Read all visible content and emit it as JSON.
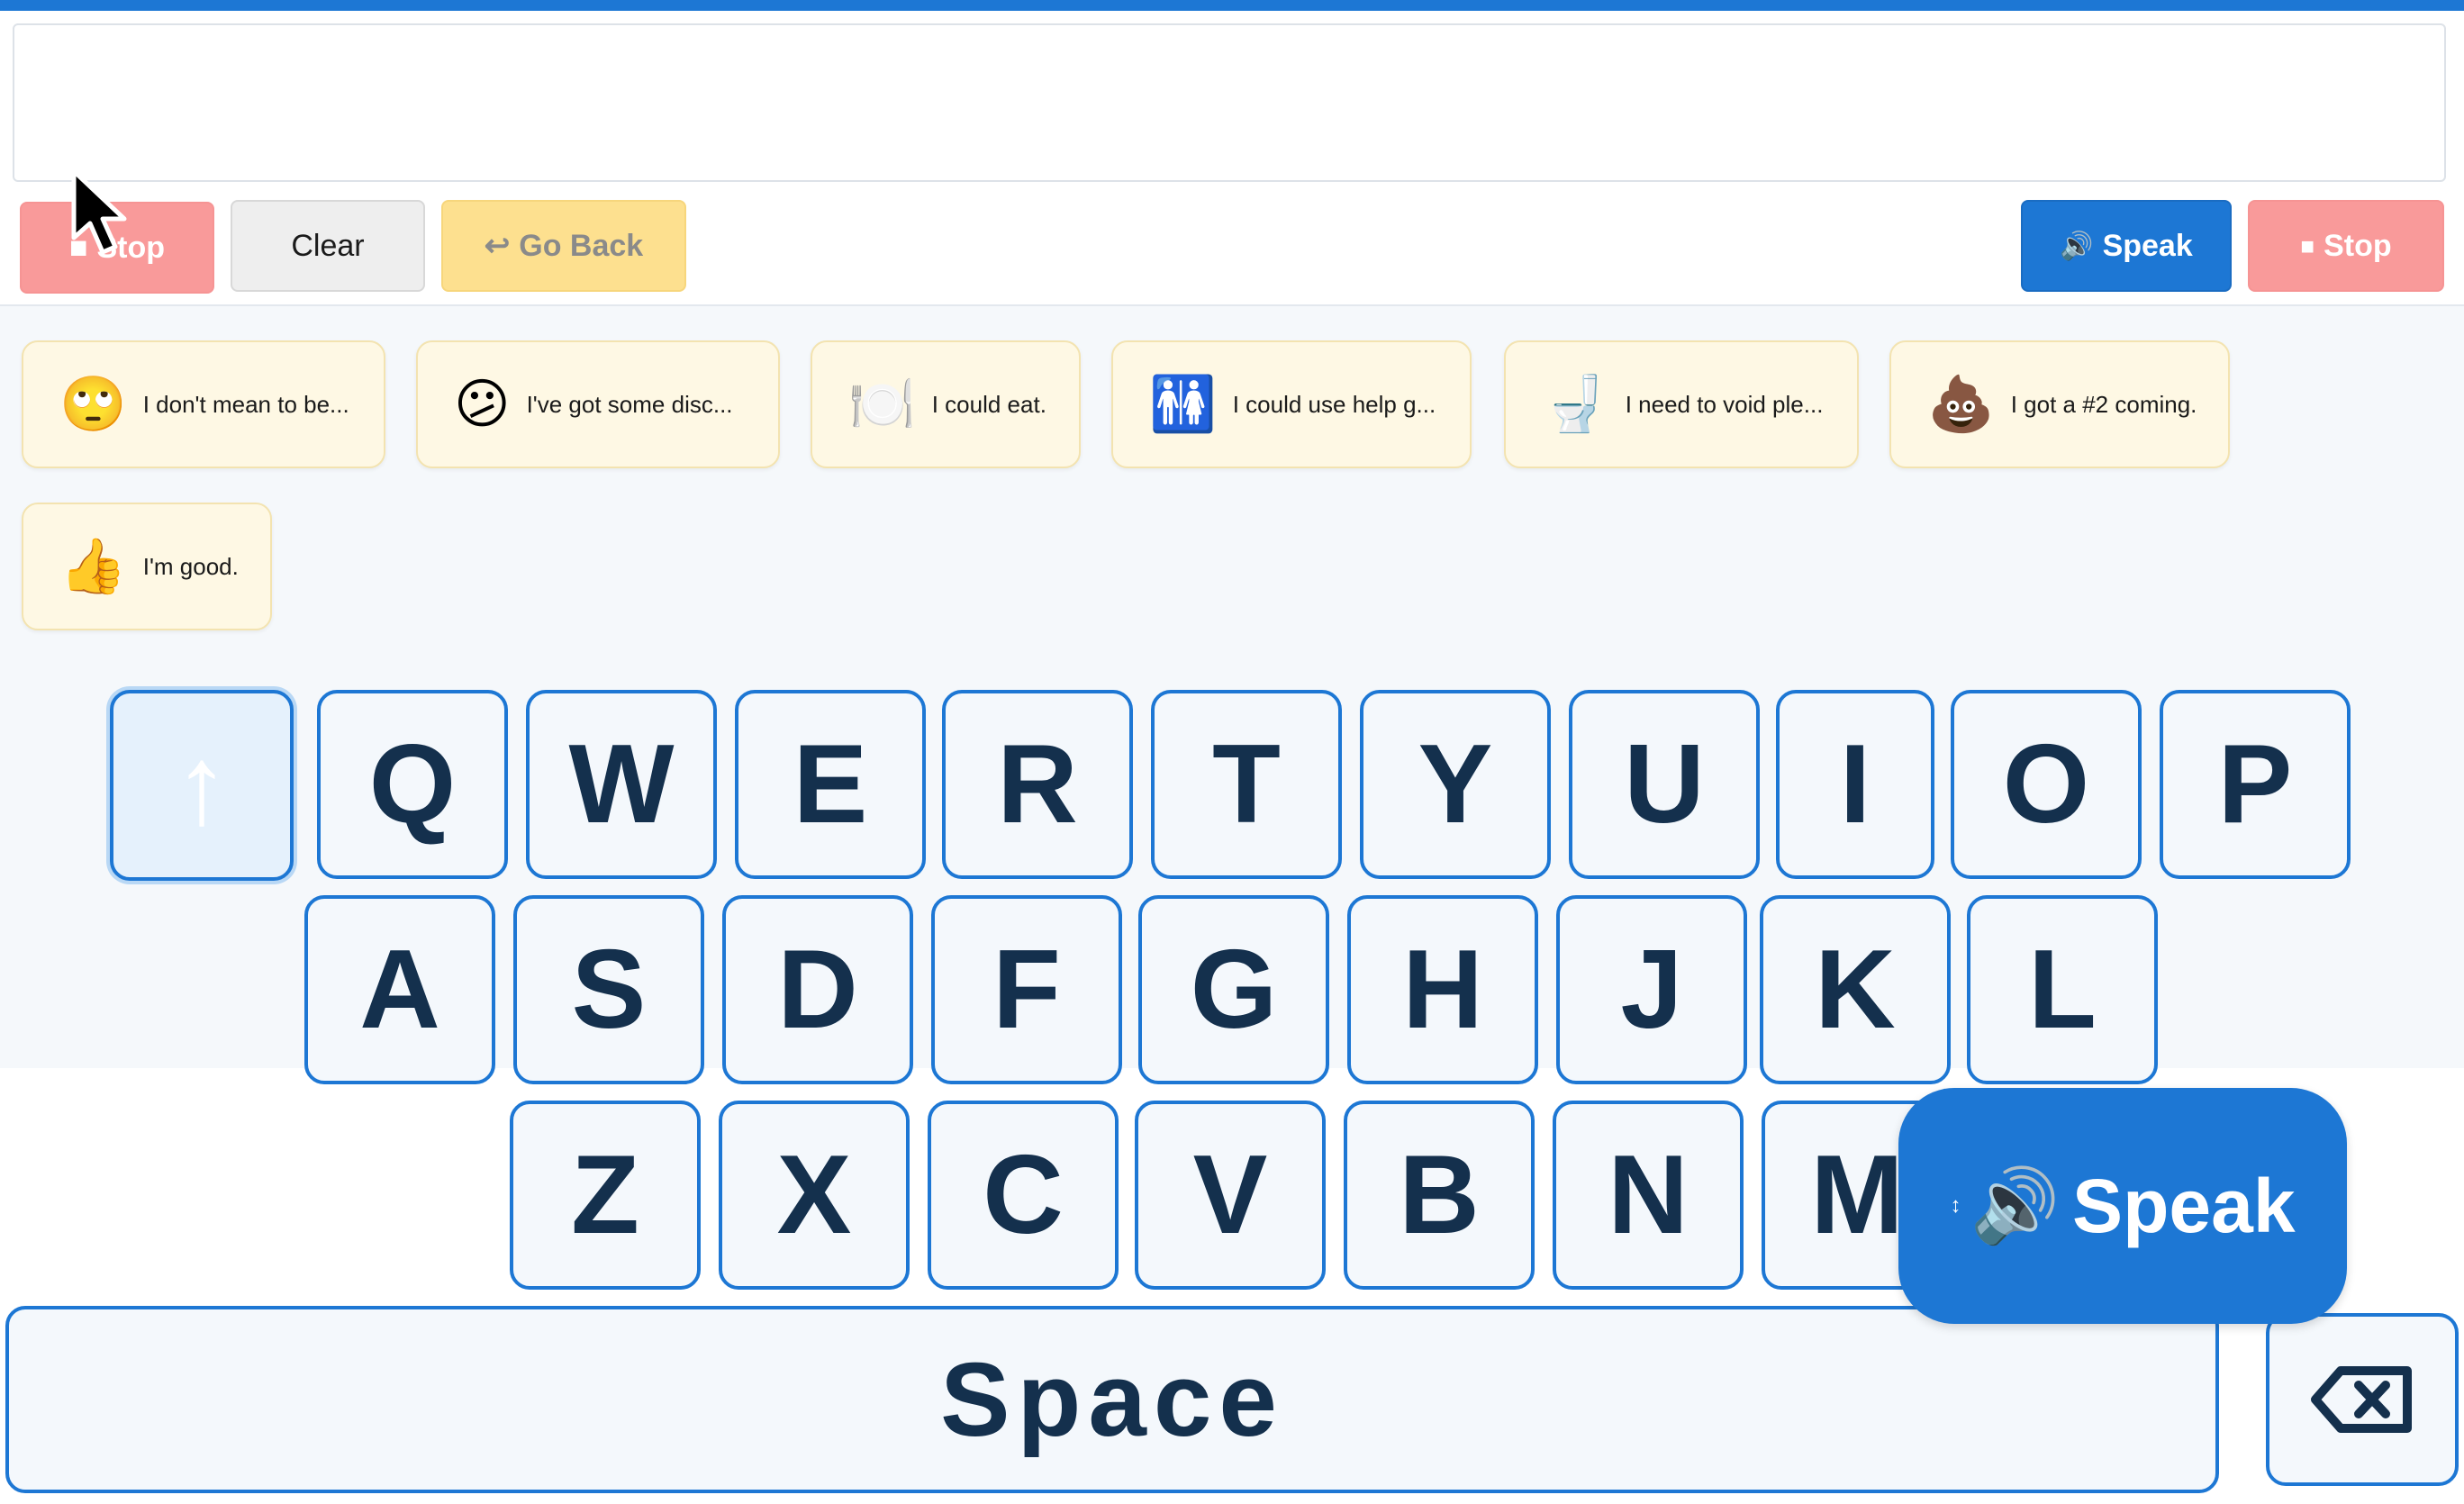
{
  "message": {
    "value": ""
  },
  "toolbar": {
    "stop_left_label": "Stop",
    "clear_label": "Clear",
    "goback_icon": "↩",
    "goback_label": "Go Back",
    "speak_icon": "🔊",
    "speak_label": "Speak",
    "stop_icon": "■",
    "stop_right_label": "Stop"
  },
  "phrases": [
    {
      "emoji": "🙄",
      "label": "I don't mean to be..."
    },
    {
      "emoji": "😕",
      "label": "I've got some disc..."
    },
    {
      "emoji": "🍽️",
      "label": "I could eat."
    },
    {
      "emoji": "🚻",
      "label": "I could use help g..."
    },
    {
      "emoji": "🚽",
      "label": "I need to void ple..."
    },
    {
      "emoji": "💩",
      "label": "I got a #2 coming."
    },
    {
      "emoji": "👍",
      "label": "I'm good."
    }
  ],
  "keyboard": {
    "shift": "↑",
    "row1": [
      "Q",
      "W",
      "E",
      "R",
      "T",
      "Y",
      "U",
      "I",
      "O",
      "P"
    ],
    "row2": [
      "A",
      "S",
      "D",
      "F",
      "G",
      "H",
      "J",
      "K",
      "L"
    ],
    "row3": [
      "Z",
      "X",
      "C",
      "V",
      "B",
      "N",
      "M"
    ],
    "space": "Space"
  },
  "speak_float": {
    "drag": "↕",
    "icon": "🔊",
    "label": "Speak"
  },
  "colors": {
    "accent": "#1d77d4",
    "stop": "#f99a9a",
    "goback": "#fde08f",
    "phrase_bg": "#fef8e4",
    "key_text": "#14304d"
  }
}
